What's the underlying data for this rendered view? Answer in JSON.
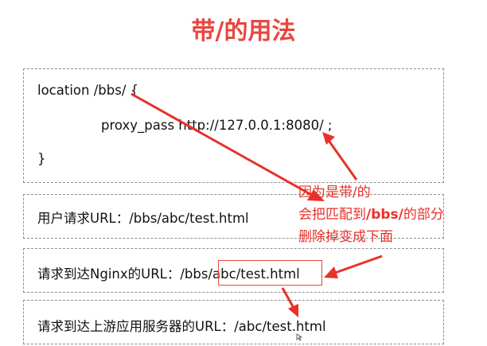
{
  "title": "带/的用法",
  "code": {
    "line1": "location /bbs/ {",
    "line2": "proxy_pass http://127.0.0.1:8080/ ;",
    "line3": "}"
  },
  "rows": {
    "user_request": "用户请求URL：/bbs/abc/test.html",
    "nginx_request_prefix": "请求到达Nginx的URL：/bbs/",
    "nginx_request_highlight": "abc/test.html",
    "upstream_request": "请求到达上游应用服务器的URL：/abc/test.html"
  },
  "note": {
    "line1": "因为是带/的",
    "line2_pre": "会把匹配到",
    "line2_bold": "/bbs/",
    "line2_post": "的部分",
    "line3": "删除掉变成下面"
  },
  "colors": {
    "accent": "#e8463f",
    "border": "#8f8f8f"
  }
}
